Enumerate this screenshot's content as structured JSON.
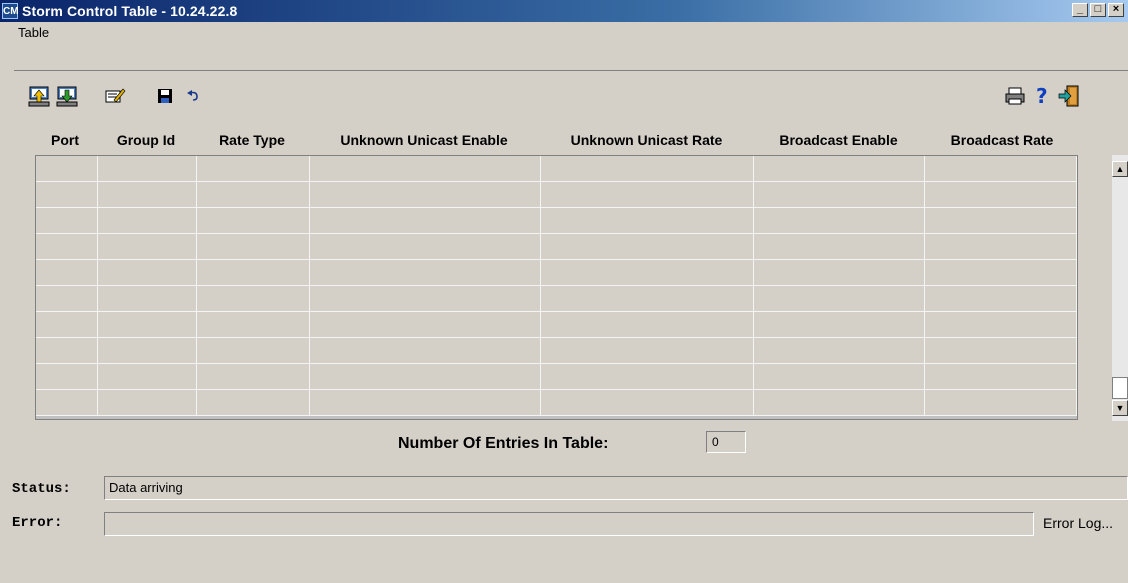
{
  "window": {
    "title": "Storm Control Table - 10.24.22.8",
    "app_icon_text": "CM",
    "minimize": "_",
    "maximize": "□",
    "close": "×"
  },
  "menu": {
    "table": "Table"
  },
  "toolbar": {
    "icons": [
      "upload-icon",
      "download-icon",
      "edit-icon",
      "save-icon",
      "undo-icon",
      "print-icon",
      "help-icon",
      "exit-icon"
    ]
  },
  "table": {
    "columns": [
      "Port",
      "Group Id",
      "Rate Type",
      "Unknown Unicast Enable",
      "Unknown Unicast Rate",
      "Broadcast Enable",
      "Broadcast Rate"
    ],
    "empty_rows": 10
  },
  "entries": {
    "label": "Number Of Entries In Table:",
    "value": "0"
  },
  "status": {
    "label": "Status:",
    "value": "Data arriving"
  },
  "error": {
    "label": "Error:",
    "value": "",
    "log_link": "Error Log..."
  }
}
